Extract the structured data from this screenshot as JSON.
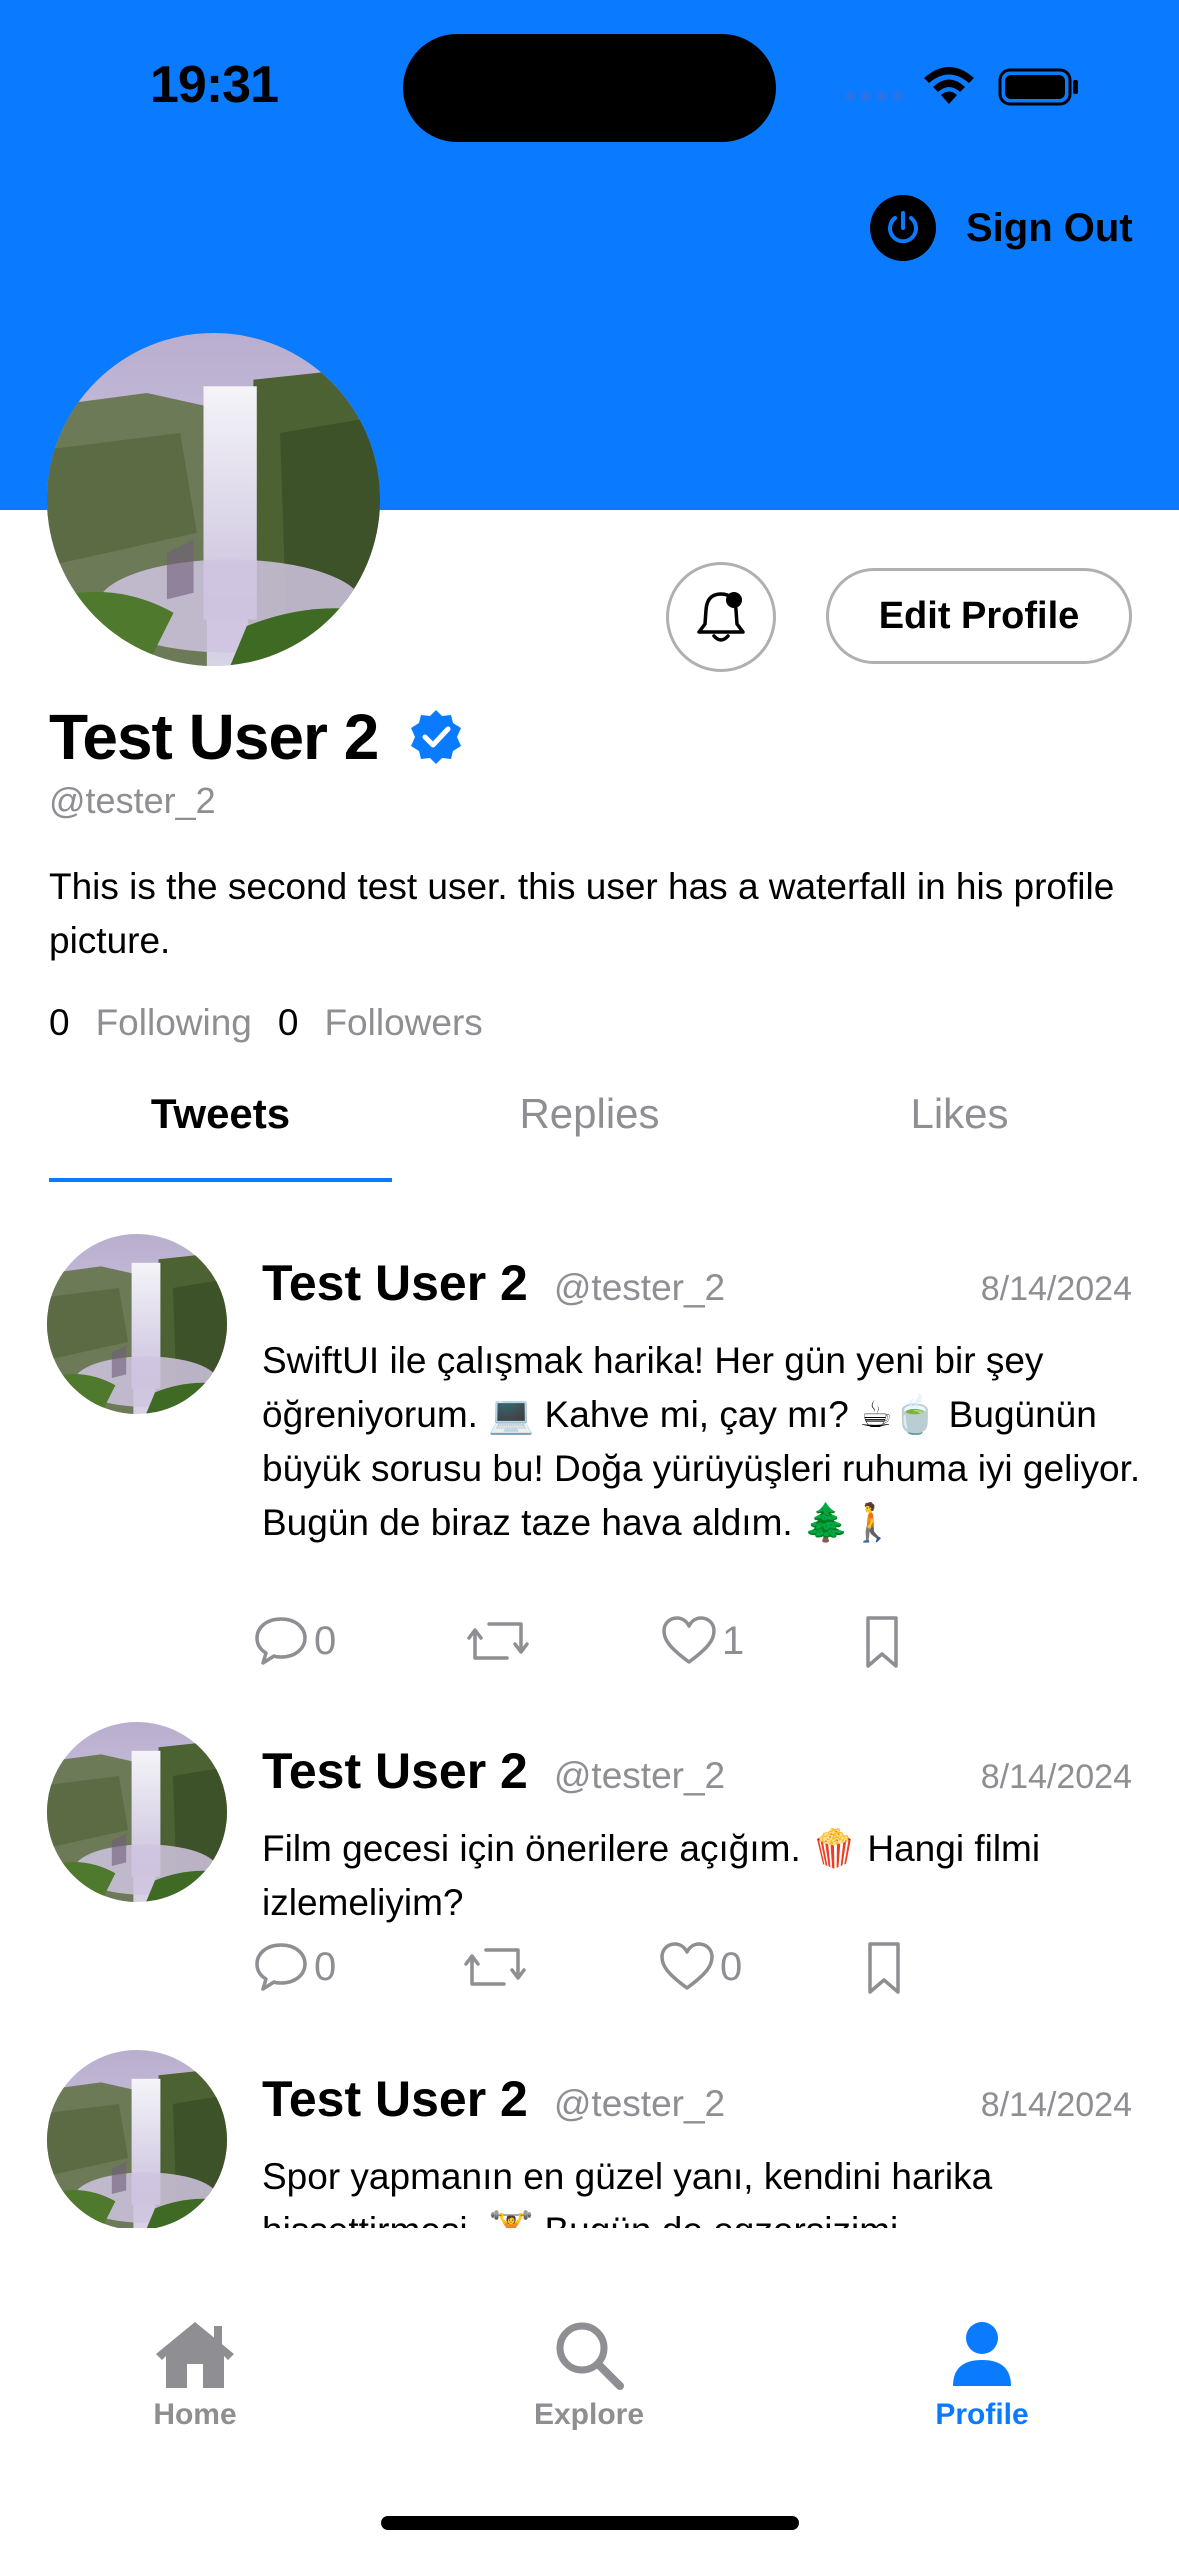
{
  "status_bar": {
    "time": "19:31"
  },
  "header": {
    "sign_out_label": "Sign Out"
  },
  "profile": {
    "name": "Test User 2",
    "handle": "@tester_2",
    "bio": "This is the second test user. this user has a waterfall in his profile picture.",
    "edit_profile_label": "Edit Profile",
    "following_count": "0",
    "following_label": "Following",
    "followers_count": "0",
    "followers_label": "Followers"
  },
  "tabs": [
    {
      "label": "Tweets",
      "selected": true
    },
    {
      "label": "Replies",
      "selected": false
    },
    {
      "label": "Likes",
      "selected": false
    }
  ],
  "tweets": [
    {
      "name": "Test User 2",
      "handle": "@tester_2",
      "date": "8/14/2024",
      "body": "SwiftUI ile çalışmak harika! Her gün yeni bir şey öğreniyorum. 💻 Kahve mi, çay mı? ☕🍵 Bugünün büyük sorusu bu! Doğa yürüyüşleri ruhuma iyi geliyor. Bugün de biraz taze hava aldım. 🌲🚶",
      "replies": "0",
      "likes": "1"
    },
    {
      "name": "Test User 2",
      "handle": "@tester_2",
      "date": "8/14/2024",
      "body": "Film gecesi için önerilere açığım. 🍿 Hangi filmi izlemeliyim?",
      "replies": "0",
      "likes": "0"
    },
    {
      "name": "Test User 2",
      "handle": "@tester_2",
      "date": "8/14/2024",
      "body": "Spor yapmanın en güzel yanı, kendini harika hissettirmesi. 🏋️ Bugün de egzersizimi"
    }
  ],
  "tab_bar": {
    "items": [
      {
        "label": "Home",
        "icon": "house-icon",
        "selected": false
      },
      {
        "label": "Explore",
        "icon": "magnifier-icon",
        "selected": false
      },
      {
        "label": "Profile",
        "icon": "person-icon",
        "selected": true
      }
    ]
  },
  "colors": {
    "accent": "#0a7bff",
    "secondary_text": "#8e8e93",
    "border": "#b0b0b0"
  }
}
